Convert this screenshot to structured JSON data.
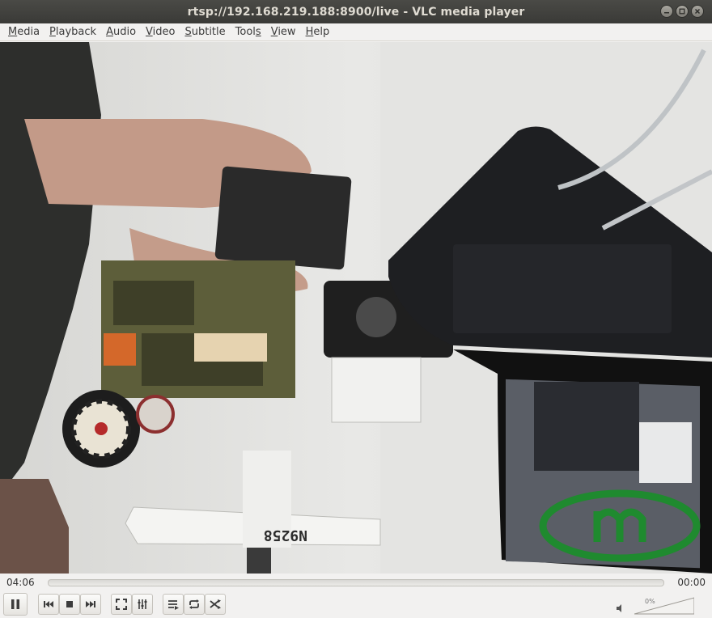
{
  "window": {
    "title": "rtsp://192.168.219.188:8900/live - VLC media player"
  },
  "menu": [
    {
      "label": "Media",
      "u": "M",
      "rest": "edia"
    },
    {
      "label": "Playback",
      "u": "P",
      "rest": "layback"
    },
    {
      "label": "Audio",
      "u": "A",
      "rest": "udio"
    },
    {
      "label": "Video",
      "u": "V",
      "rest": "ideo"
    },
    {
      "label": "Subtitle",
      "u": "S",
      "rest": "ubtitle"
    },
    {
      "label": "Tools",
      "pre": "Tool",
      "u": "s",
      "rest": ""
    },
    {
      "label": "View",
      "u": "V",
      "rest": "iew"
    },
    {
      "label": "Help",
      "u": "H",
      "rest": "elp"
    }
  ],
  "player": {
    "elapsed": "04:06",
    "total": "00:00",
    "progress": 0,
    "volume_label": "0%",
    "volume": 0
  },
  "video": {
    "plane_registration": "N9258"
  },
  "icons": {
    "pause": "pause-icon",
    "previous": "previous-icon",
    "stop": "stop-icon",
    "next": "next-icon",
    "fullscreen": "fullscreen-icon",
    "extended": "extended-settings-icon",
    "playlist": "playlist-icon",
    "loop": "loop-icon",
    "shuffle": "shuffle-icon",
    "volume": "speaker-icon"
  },
  "colors": {
    "titlebar": "#3c3b37",
    "logo_green": "#1f8a2f"
  }
}
